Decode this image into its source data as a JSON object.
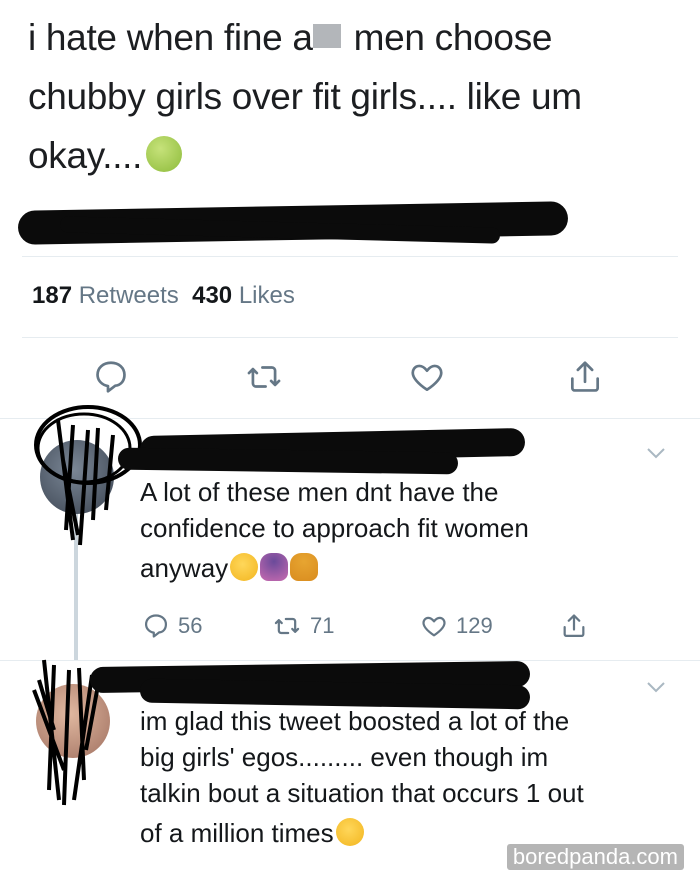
{
  "main_tweet": {
    "line1_before": "i hate when fine a",
    "line1_after": " men choose",
    "line2": "chubby girls over fit girls.... like um",
    "line3": "okay....",
    "emoji": "nauseated-face-emoji",
    "retweets_count": "187",
    "retweets_label": "Retweets",
    "likes_count": "430",
    "likes_label": "Likes"
  },
  "actions_main": {
    "reply_icon": "reply-icon",
    "retweet_icon": "retweet-icon",
    "like_icon": "heart-icon",
    "share_icon": "share-icon"
  },
  "reply1": {
    "text_line1": "A lot of these men dnt have the",
    "text_line2": "confidence to approach fit women",
    "text_line3": "anyway",
    "emojis": [
      "crying-face-emoji",
      "shrug-woman-emoji",
      "tipping-hand-woman-emoji"
    ],
    "reply_count": "56",
    "retweet_count": "71",
    "like_count": "129"
  },
  "reply2": {
    "text_line1": "im glad this tweet boosted a lot of the",
    "text_line2": "big girls' egos......... even though im",
    "text_line3": "talkin bout a situation that occurs 1 out",
    "text_line4": "of a million times",
    "emoji": "eye-roll-emoji"
  },
  "watermark": "boredpanda.com",
  "colors": {
    "text": "#14171a",
    "muted": "#657786",
    "divider": "#e6ecf0",
    "redaction": "#0b0b0b"
  }
}
